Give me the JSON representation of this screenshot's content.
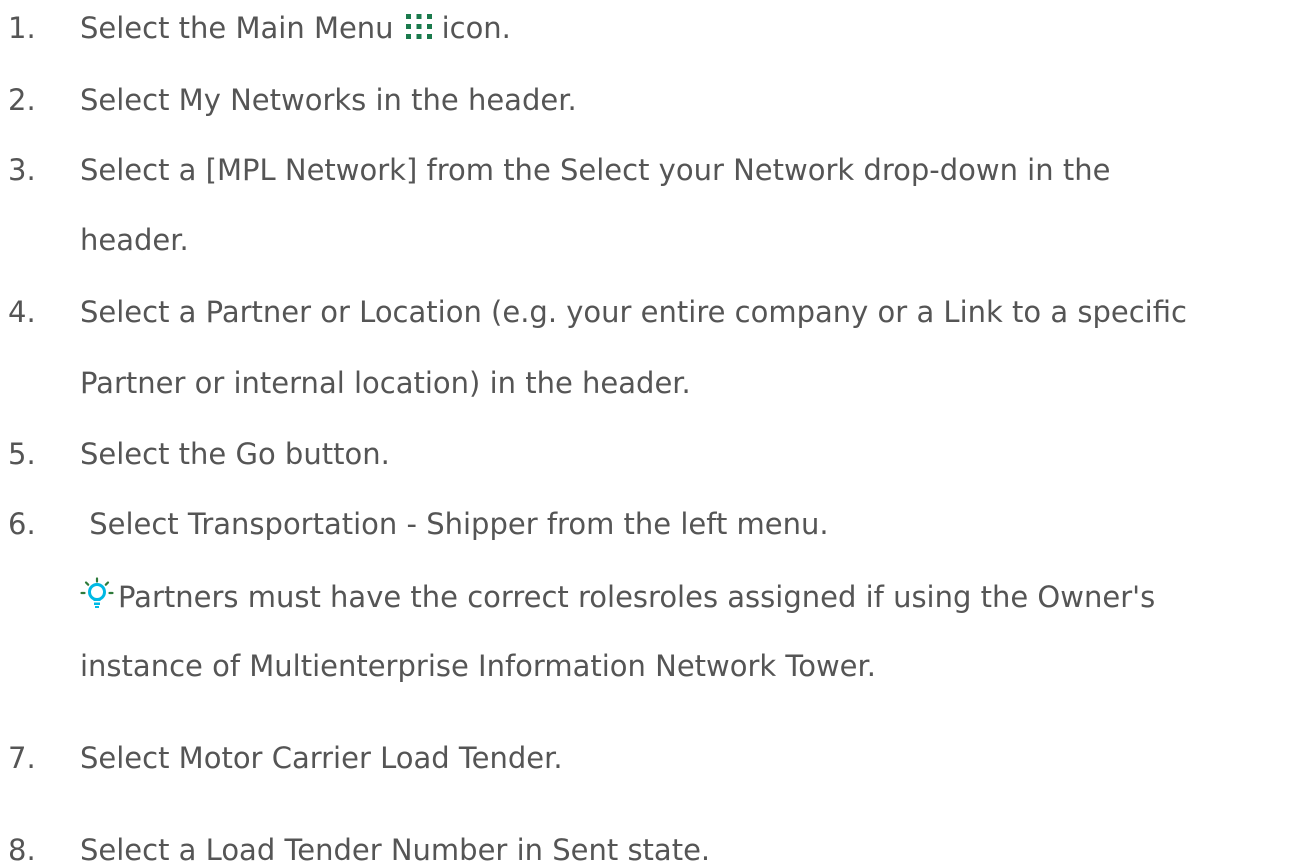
{
  "steps": [
    {
      "number": "1.",
      "before_icon": "Select the Main Menu",
      "icon": "main-menu-grid-icon",
      "after_icon": "icon."
    },
    {
      "number": "2.",
      "text": "Select My Networks in the header."
    },
    {
      "number": "3.",
      "line1": "Select a [MPL Network] from the Select your Network drop-down in the",
      "line2": "header."
    },
    {
      "number": "4.",
      "line1": "Select a Partner or Location (e.g. your entire company or a Link to a specific",
      "line2": "Partner or internal location) in the header."
    },
    {
      "number": "5.",
      "text": "Select the Go button."
    },
    {
      "number": "6.",
      "text": " Select Transportation - Shipper from the left menu."
    },
    {
      "number": "7.",
      "text": "Select Motor Carrier Load Tender."
    },
    {
      "number": "8.",
      "text": "Select a Load Tender Number in Sent state."
    }
  ],
  "tip": {
    "icon": "lightbulb-icon",
    "line1": "Partners must have the correct rolesroles assigned if using the Owner's",
    "line2": "instance of Multienterprise Information Network Tower."
  },
  "colors": {
    "text": "#555555",
    "menu_icon": "#1a7a4c",
    "tip_icon_bulb": "#00b9e4",
    "tip_icon_rays": "#2e7a3a"
  }
}
